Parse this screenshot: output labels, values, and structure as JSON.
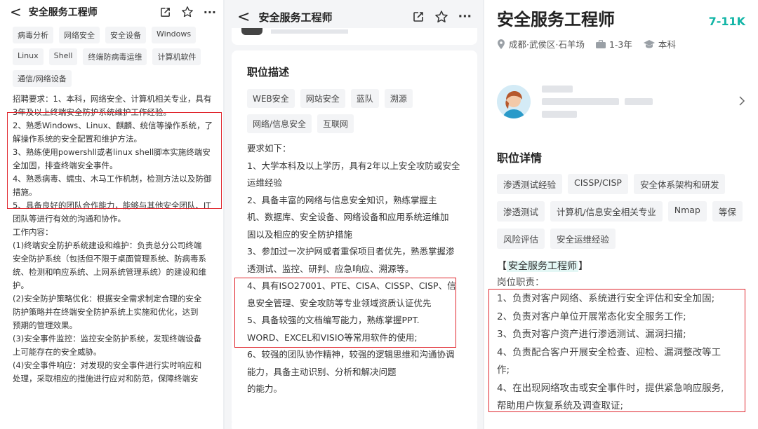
{
  "panel1": {
    "header": {
      "back": "<",
      "title": "安全服务工程师",
      "share": "share",
      "star": "star",
      "more": "···"
    },
    "tags": [
      "病毒分析",
      "网络安全",
      "安全设备",
      "Windows",
      "Linux",
      "Shell",
      "终端防病毒运维",
      "计算机软件",
      "通信/网络设备"
    ],
    "body": "招聘要求：1、本科，网络安全、计算机相关专业，具有\n3年及以上终端安全防护系统维护工作经验。\n2、熟悉Windows、Linux、麒麟、统信等操作系统，了\n解操作系统的安全配置和维护方法。\n3、熟练使用powershll或者linux shell脚本实施终端安\n全加固，排查终端安全事件。\n4、熟悉病毒、蠕虫、木马工作机制，检测方法以及防御\n措施。\n5、具备良好的团队合作能力，能够与其他安全团队、IT\n团队等进行有效的沟通和协作。\n工作内容：\n(1)终端安全防护系统建设和维护：负责总分公司终端\n安全防护系统（包括但不限于桌面管理系统、防病毒系\n统、检测和响应系统、上网系统管理系统）的建设和维\n护。\n(2)安全防护策略优化：根据安全需求制定合理的安全\n防护策略并在终端安全防护系统上实施和优化，达到\n预期的管理效果。\n(3)安全事件监控：监控安全防护系统，发现终端设备\n上可能存在的安全威胁。\n(4)安全事件响应：对发现的安全事件进行实时响应和\n处理，采取相应的措施进行应对和防范，保障终端安"
  },
  "panel2": {
    "header": {
      "back": "<",
      "title": "安全服务工程师",
      "share": "share",
      "star": "star",
      "more": "···"
    },
    "section_title": "职位描述",
    "tags": [
      "WEB安全",
      "网站安全",
      "蓝队",
      "溯源",
      "网络/信息安全",
      "互联网"
    ],
    "body": "要求如下：\n1、大学本科及以上学历，具有2年以上安全攻防或安全\n运维经验\n2、具备丰富的网络与信息安全知识，熟练掌握主\n机、数据库、安全设备、网络设备和应用系统运维加\n固以及相应的安全防护措施\n3、参加过一次护网或者重保项目者优先，熟悉掌握渗\n透测试、监控、研判、应急响应、溯源等。\n4、具有ISO27001、PTE、CISA、CISSP、CISP、信\n息安全管理、安全攻防等专业领域资质认证优先\n5、具备较强的文档编写能力，熟练掌握PPT.\nWORD、EXCEL和VISIO等常用软件的使用;\n6、较强的团队协作精神，较强的逻辑思维和沟通协调\n能力，具备主动识别、分析和解决问题\n的能力。"
  },
  "panel3": {
    "job_title": "安全服务工程师",
    "salary": "7-11K",
    "location": "成都·武侯区·石羊场",
    "experience": "1-3年",
    "education": "本科",
    "section_title": "职位详情",
    "tags": [
      "渗透测试经验",
      "CISSP/CISP",
      "安全体系架构和研发",
      "渗透测试",
      "计算机/信息安全相关专业",
      "Nmap",
      "等保",
      "风险评估",
      "安全运维经验"
    ],
    "role_prefix": "【",
    "role_name": "安全服务工程师",
    "role_suffix": "】",
    "duty_label": "岗位职责：",
    "body": "1、负责对客户网络、系统进行安全评估和安全加固;\n2、负责对客户单位开展常态化安全服务工作;\n3、负责对客户资产进行渗透测试、漏洞扫描;\n4、负责配合客户开展安全检查、迎检、漏洞整改等工\n作;\n4、在出现网络攻击或安全事件时，提供紧急响应服务,\n帮助用户恢复系统及调查取证;"
  },
  "colors": {
    "accent": "#12b5a6",
    "highlight_box": "#e0262d",
    "tag_bg": "#f3f4f6"
  }
}
